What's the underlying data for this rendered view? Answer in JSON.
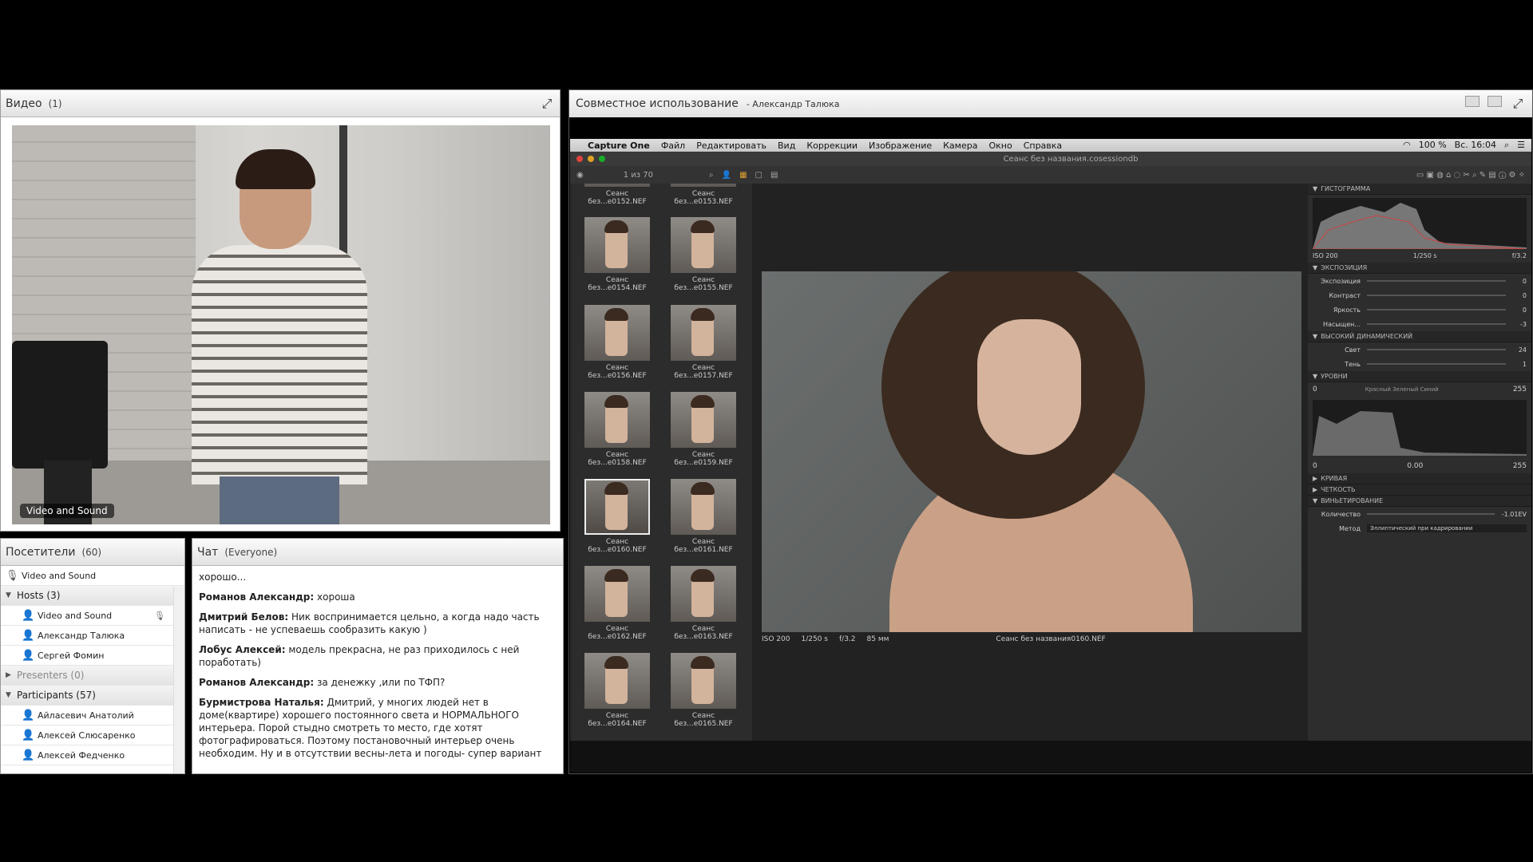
{
  "video_pod": {
    "title": "Видео",
    "count": "(1)",
    "label": "Video and Sound"
  },
  "attendees_pod": {
    "title": "Посетители",
    "count": "(60)",
    "items": [
      {
        "label": "Video and Sound",
        "kind": "self"
      },
      {
        "label": "Hosts (3)",
        "kind": "group"
      },
      {
        "label": "Video and Sound",
        "kind": "member"
      },
      {
        "label": "Александр Талюка",
        "kind": "member"
      },
      {
        "label": "Сергей Фомин",
        "kind": "member"
      },
      {
        "label": "Presenters (0)",
        "kind": "group-collapsed"
      },
      {
        "label": "Participants (57)",
        "kind": "group"
      },
      {
        "label": "Айласевич Анатолий",
        "kind": "member"
      },
      {
        "label": "Алексей Слюсаренко",
        "kind": "member"
      },
      {
        "label": "Алексей Федченко",
        "kind": "member"
      }
    ]
  },
  "chat_pod": {
    "title": "Чат",
    "audience": "(Everyone)",
    "messages": [
      {
        "author": "",
        "text": "хорошо..."
      },
      {
        "author": "Романов Александр:",
        "text": " хороша"
      },
      {
        "author": "Дмитрий Белов:",
        "text": " Ник воспринимается цельно, а когда надо часть написать - не успеваешь сообразить какую )"
      },
      {
        "author": "Лобус Алексей:",
        "text": " модель прекрасна, не раз приходилось с ней поработать)"
      },
      {
        "author": "Романов Александр:",
        "text": " за денежку ,или по ТФП?"
      },
      {
        "author": "Бурмистрова Наталья:",
        "text": " Дмитрий, у многих людей нет в доме(квартире) хорошего постоянного света и НОРМАЛЬНОГО интерьера. Порой стыдно смотреть то место, где хотят фотографироваться. Поэтому постановочный интерьер очень необходим. Ну и в отсутствии весны-лета и погоды- супер вариант"
      }
    ]
  },
  "share_pod": {
    "title": "Совместное использование",
    "presenter": "- Александр Талюка"
  },
  "mac": {
    "menubar": {
      "app": "Capture One",
      "items": [
        "Файл",
        "Редактировать",
        "Вид",
        "Коррекции",
        "Изображение",
        "Камера",
        "Окно",
        "Справка"
      ],
      "battery": "100 %",
      "clock": "Вс. 16:04"
    },
    "window_title": "Сеанс без названия.cosessiondb",
    "browser_count": "1 из 70",
    "thumbnails": [
      {
        "caption": "Сеанс без...e0152.NEF"
      },
      {
        "caption": "Сеанс без...e0153.NEF"
      },
      {
        "caption": "Сеанс без...e0154.NEF"
      },
      {
        "caption": "Сеанс без...e0155.NEF"
      },
      {
        "caption": "Сеанс без...e0156.NEF"
      },
      {
        "caption": "Сеанс без...e0157.NEF"
      },
      {
        "caption": "Сеанс без...e0158.NEF"
      },
      {
        "caption": "Сеанс без...e0159.NEF"
      },
      {
        "caption": "Сеанс без...e0160.NEF"
      },
      {
        "caption": "Сеанс без...e0161.NEF"
      },
      {
        "caption": "Сеанс без...e0162.NEF"
      },
      {
        "caption": "Сеанс без...e0163.NEF"
      },
      {
        "caption": "Сеанс без...e0164.NEF"
      },
      {
        "caption": "Сеанс без...e0165.NEF"
      }
    ],
    "viewer": {
      "iso": "ISO 200",
      "shutter": "1/250 s",
      "aperture": "f/3.2",
      "focal": "85 мм",
      "filename": "Сеанс без названия0160.NEF"
    },
    "tools": {
      "histogram": {
        "title": "ГИСТОГРАММА",
        "iso": "ISO 200",
        "shutter": "1/250 s",
        "aperture": "f/3.2"
      },
      "exposure": {
        "title": "ЭКСПОЗИЦИЯ",
        "rows": [
          {
            "label": "Экспозиция",
            "value": "0"
          },
          {
            "label": "Контраст",
            "value": "0"
          },
          {
            "label": "Яркость",
            "value": "0"
          },
          {
            "label": "Насыщен...",
            "value": "-3"
          }
        ]
      },
      "hdr": {
        "title": "ВЫСОКИЙ ДИНАМИЧЕСКИЙ",
        "rows": [
          {
            "label": "Свет",
            "value": "24"
          },
          {
            "label": "Тень",
            "value": "1"
          }
        ]
      },
      "levels": {
        "title": "УРОВНИ",
        "left": "0",
        "right": "255",
        "channels": "Красный Зеленый Синий",
        "mid": "0.00",
        "out_left": "0",
        "out_right": "255"
      },
      "curve": {
        "title": "КРИВАЯ"
      },
      "clarity": {
        "title": "ЧЕТКОСТЬ"
      },
      "vignetting": {
        "title": "ВИНЬЕТИРОВАНИЕ",
        "amount_label": "Количество",
        "amount_value": "-1.01EV",
        "method_label": "Метод",
        "method_value": "Эллиптический при кадрировании"
      }
    }
  }
}
